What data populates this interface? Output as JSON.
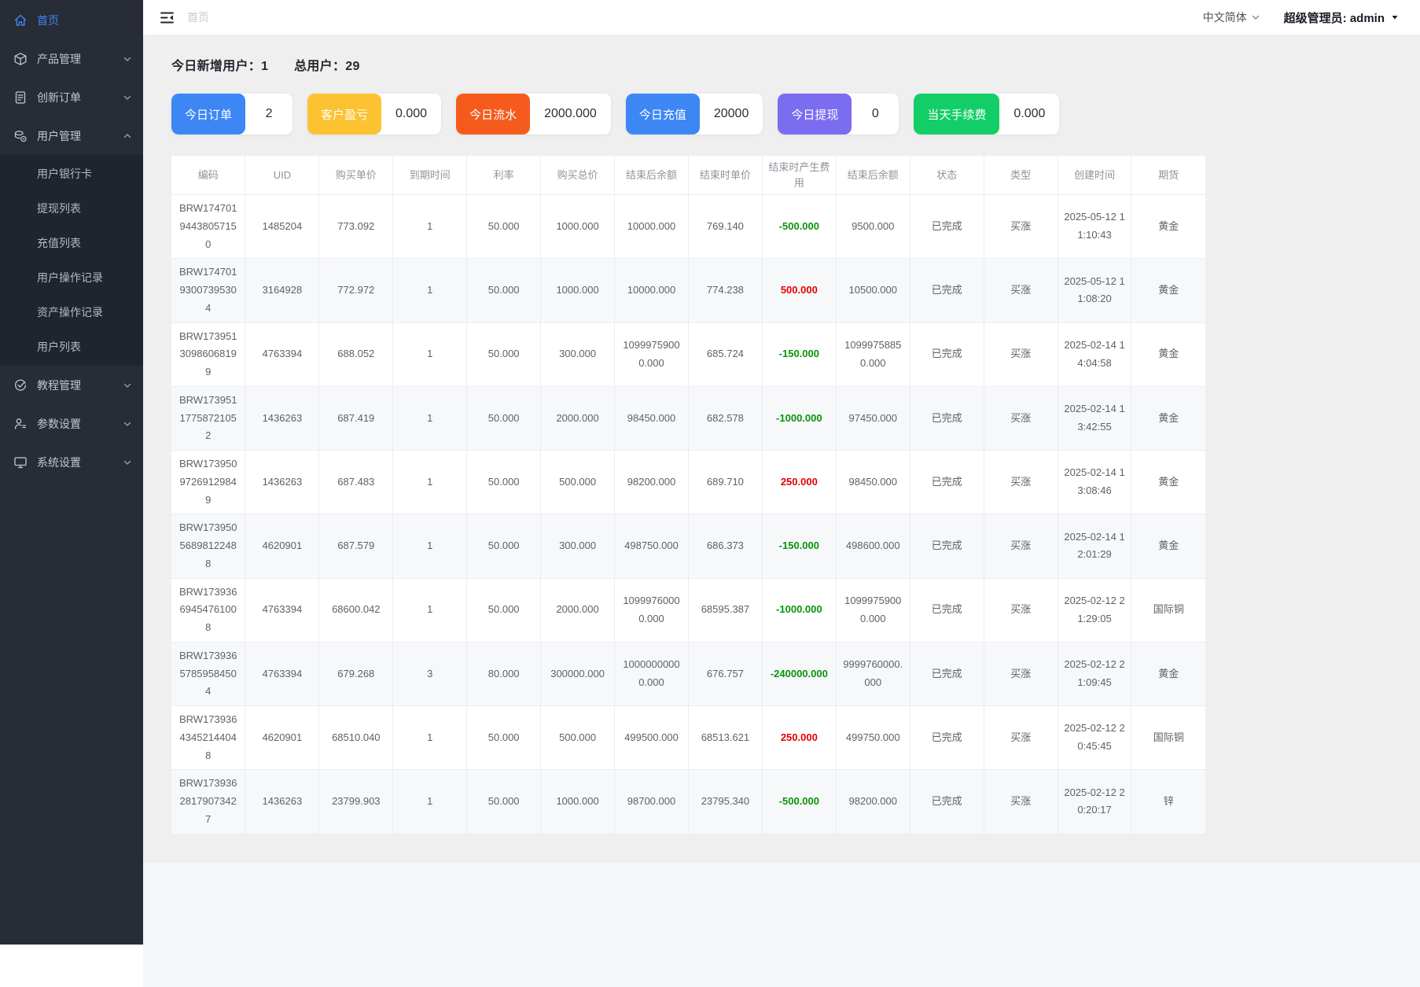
{
  "colors": {
    "accent": "#3d87f5",
    "fee_negative": "#0a9308",
    "fee_positive": "#e60000"
  },
  "topbar": {
    "breadcrumb": "首页",
    "language": "中文简体",
    "user": "超级管理员: admin"
  },
  "summary": {
    "new_users_label": "今日新增用户：",
    "new_users": "1",
    "total_users_label": "总用户：",
    "total_users": "29"
  },
  "sidebar": {
    "items": [
      {
        "id": "home",
        "icon": "home",
        "label": "首页",
        "active": true
      },
      {
        "id": "product-management",
        "icon": "cube",
        "label": "产品管理",
        "chevron": "down"
      },
      {
        "id": "innovation-orders",
        "icon": "document",
        "label": "创新订单",
        "chevron": "down"
      },
      {
        "id": "user-management",
        "icon": "users",
        "label": "用户管理",
        "chevron": "up",
        "children": [
          {
            "id": "user-bank-cards",
            "label": "用户银行卡"
          },
          {
            "id": "withdrawal-list",
            "label": "提现列表"
          },
          {
            "id": "recharge-list",
            "label": "充值列表"
          },
          {
            "id": "user-operation-log",
            "label": "用户操作记录"
          },
          {
            "id": "asset-operation-log",
            "label": "资产操作记录"
          },
          {
            "id": "user-list",
            "label": "用户列表"
          }
        ]
      },
      {
        "id": "tutorial-management",
        "icon": "tutorial",
        "label": "教程管理",
        "chevron": "down"
      },
      {
        "id": "parameter-settings",
        "icon": "params",
        "label": "参数设置",
        "chevron": "down"
      },
      {
        "id": "system-settings",
        "icon": "system",
        "label": "系统设置",
        "chevron": "down"
      }
    ]
  },
  "stat_cards": [
    {
      "id": "today-orders",
      "label": "今日订单",
      "value": "2",
      "color": "#3d87f5"
    },
    {
      "id": "customer-pnl",
      "label": "客户盈亏",
      "value": "0.000",
      "color": "#fbc331"
    },
    {
      "id": "today-turnover",
      "label": "今日流水",
      "value": "2000.000",
      "color": "#f55b1d"
    },
    {
      "id": "today-recharge",
      "label": "今日充值",
      "value": "20000",
      "color": "#3d87f5"
    },
    {
      "id": "today-withdrawal",
      "label": "今日提现",
      "value": "0",
      "color": "#7b6cf0"
    },
    {
      "id": "today-fees",
      "label": "当天手续费",
      "value": "0.000",
      "color": "#13ce66"
    }
  ],
  "table": {
    "headers": [
      "编码",
      "UID",
      "购买单价",
      "到期时间",
      "利率",
      "购买总价",
      "结束后余额",
      "结束时单价",
      "结束时产生费用",
      "结束后余额",
      "状态",
      "类型",
      "创建时间",
      "期货"
    ],
    "fee_column_index": 8,
    "rows": [
      [
        "BRW17470194438057150",
        "1485204",
        "773.092",
        "1",
        "50.000",
        "1000.000",
        "10000.000",
        "769.140",
        "-500.000",
        "9500.000",
        "已完成",
        "买涨",
        "2025-05-12 11:10:43",
        "黄金"
      ],
      [
        "BRW17470193007395304",
        "3164928",
        "772.972",
        "1",
        "50.000",
        "1000.000",
        "10000.000",
        "774.238",
        "500.000",
        "10500.000",
        "已完成",
        "买涨",
        "2025-05-12 11:08:20",
        "黄金"
      ],
      [
        "BRW17395130986068199",
        "4763394",
        "688.052",
        "1",
        "50.000",
        "300.000",
        "10999759000.000",
        "685.724",
        "-150.000",
        "10999758850.000",
        "已完成",
        "买涨",
        "2025-02-14 14:04:58",
        "黄金"
      ],
      [
        "BRW17395117758721052",
        "1436263",
        "687.419",
        "1",
        "50.000",
        "2000.000",
        "98450.000",
        "682.578",
        "-1000.000",
        "97450.000",
        "已完成",
        "买涨",
        "2025-02-14 13:42:55",
        "黄金"
      ],
      [
        "BRW17395097269129849",
        "1436263",
        "687.483",
        "1",
        "50.000",
        "500.000",
        "98200.000",
        "689.710",
        "250.000",
        "98450.000",
        "已完成",
        "买涨",
        "2025-02-14 13:08:46",
        "黄金"
      ],
      [
        "BRW17395056898122488",
        "4620901",
        "687.579",
        "1",
        "50.000",
        "300.000",
        "498750.000",
        "686.373",
        "-150.000",
        "498600.000",
        "已完成",
        "买涨",
        "2025-02-14 12:01:29",
        "黄金"
      ],
      [
        "BRW17393669454761008",
        "4763394",
        "68600.042",
        "1",
        "50.000",
        "2000.000",
        "10999760000.000",
        "68595.387",
        "-1000.000",
        "10999759000.000",
        "已完成",
        "买涨",
        "2025-02-12 21:29:05",
        "国际铜"
      ],
      [
        "BRW17393657859584504",
        "4763394",
        "679.268",
        "3",
        "80.000",
        "300000.000",
        "10000000000.000",
        "676.757",
        "-240000.000",
        "9999760000.000",
        "已完成",
        "买涨",
        "2025-02-12 21:09:45",
        "黄金"
      ],
      [
        "BRW17393643452144048",
        "4620901",
        "68510.040",
        "1",
        "50.000",
        "500.000",
        "499500.000",
        "68513.621",
        "250.000",
        "499750.000",
        "已完成",
        "买涨",
        "2025-02-12 20:45:45",
        "国际铜"
      ],
      [
        "BRW17393628179073427",
        "1436263",
        "23799.903",
        "1",
        "50.000",
        "1000.000",
        "98700.000",
        "23795.340",
        "-500.000",
        "98200.000",
        "已完成",
        "买涨",
        "2025-02-12 20:20:17",
        "锌"
      ]
    ]
  }
}
